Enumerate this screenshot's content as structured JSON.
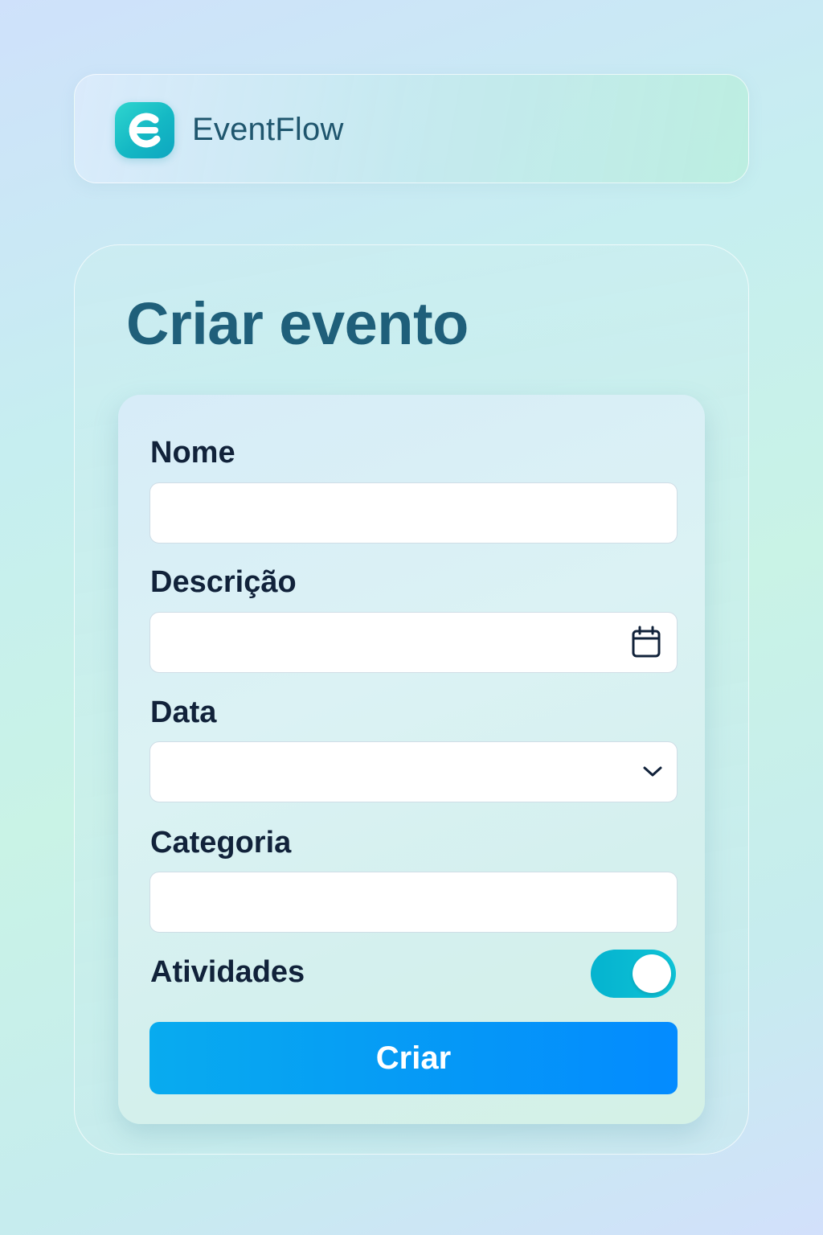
{
  "app": {
    "name": "EventFlow",
    "logo_icon": "eventflow-logo-icon"
  },
  "page": {
    "title": "Criar evento"
  },
  "form": {
    "fields": [
      {
        "label": "Nome",
        "value": "",
        "icon": ""
      },
      {
        "label": "Descrição",
        "value": "",
        "icon": "calendar-icon"
      },
      {
        "label": "Data",
        "value": "",
        "icon": "chevron-down-icon"
      },
      {
        "label": "Categoria",
        "value": "",
        "icon": ""
      }
    ],
    "toggle": {
      "label": "Atividades",
      "on": true
    },
    "submit_label": "Criar"
  },
  "colors": {
    "accent": "#05b3cf",
    "button": "#0597f7",
    "title": "#1f5f7a",
    "label": "#11223a"
  }
}
